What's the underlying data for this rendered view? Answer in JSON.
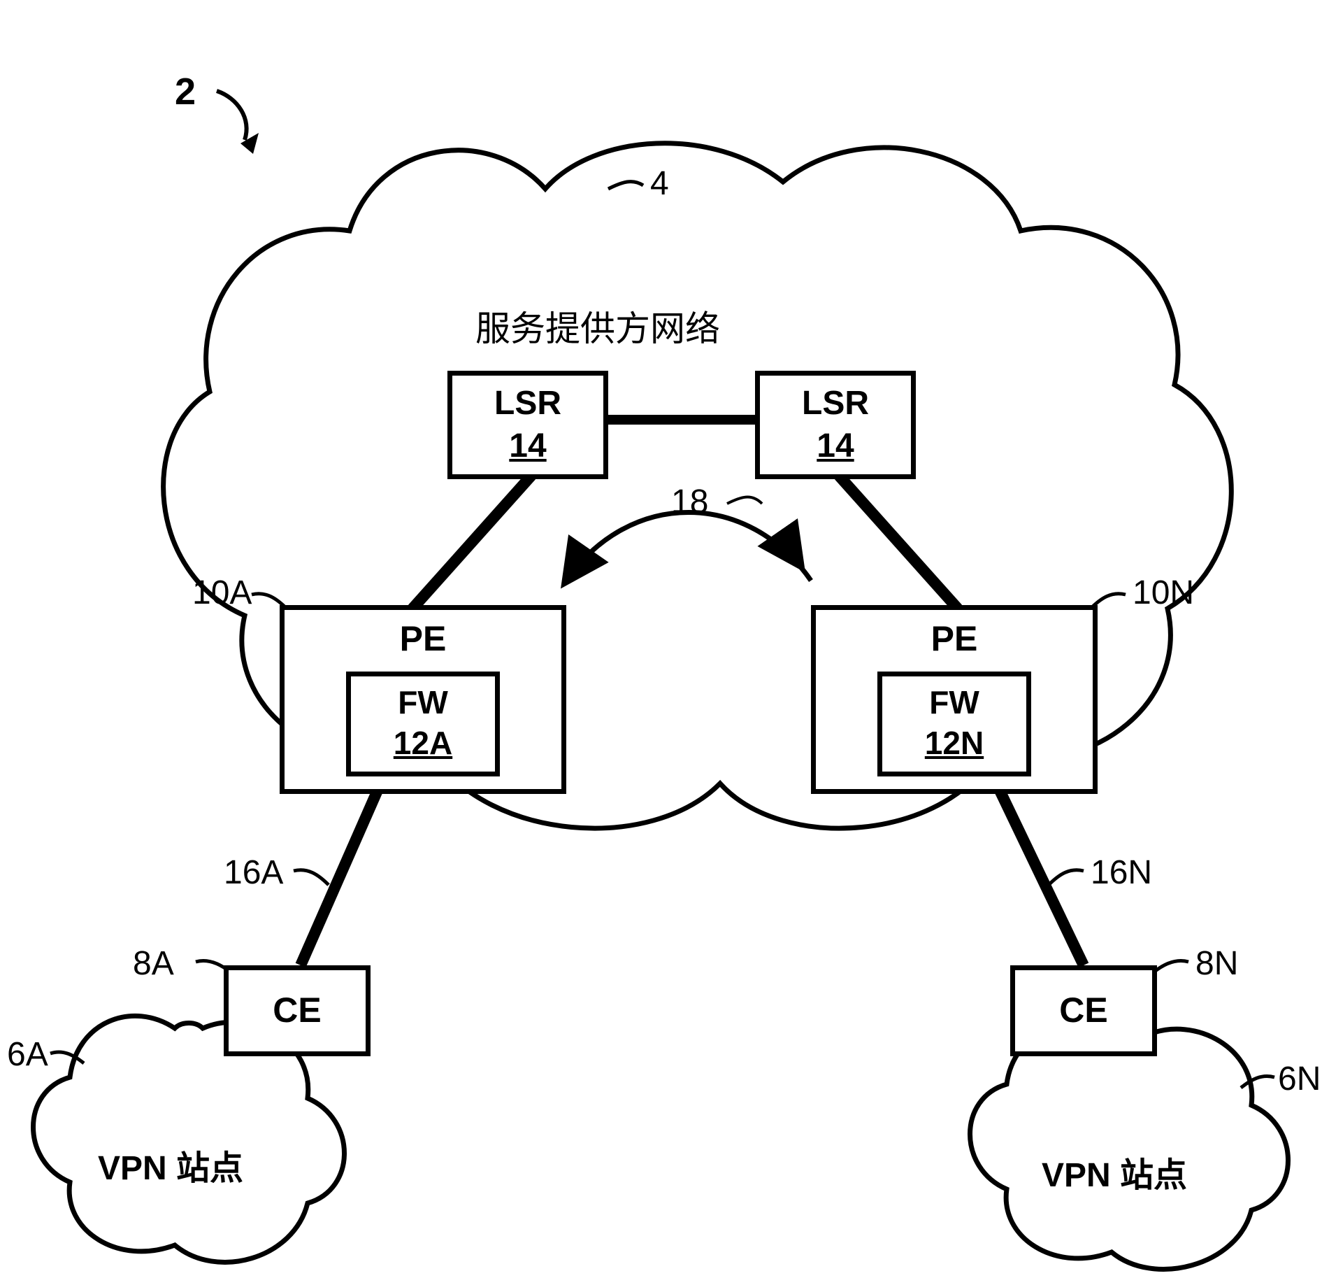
{
  "figure_ref": "2",
  "cloud_main": {
    "ref": "4",
    "title": "服务提供方网络"
  },
  "lsr_left": {
    "label": "LSR",
    "ref": "14"
  },
  "lsr_right": {
    "label": "LSR",
    "ref": "14"
  },
  "arc_ref": "18",
  "pe_left": {
    "ref": "10A",
    "label": "PE",
    "fw": {
      "label": "FW",
      "ref": "12A"
    }
  },
  "pe_right": {
    "ref": "10N",
    "label": "PE",
    "fw": {
      "label": "FW",
      "ref": "12N"
    }
  },
  "link_left_ref": "16A",
  "link_right_ref": "16N",
  "ce_left": {
    "ref": "8A",
    "label": "CE"
  },
  "ce_right": {
    "ref": "8N",
    "label": "CE"
  },
  "vpn_left": {
    "ref": "6A",
    "label": "VPN 站点"
  },
  "vpn_right": {
    "ref": "6N",
    "label": "VPN 站点"
  }
}
